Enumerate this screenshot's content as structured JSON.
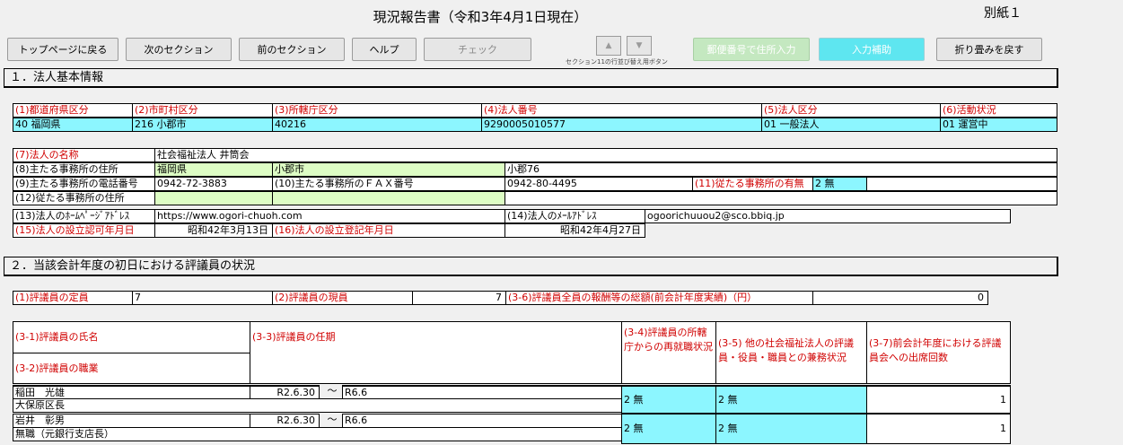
{
  "header": {
    "title": "現況報告書（令和3年4月1日現在）",
    "annex": "別紙１"
  },
  "toolbar": {
    "top_page": "トップページに戻る",
    "next_section": "次のセクション",
    "prev_section": "前のセクション",
    "help": "ヘルプ",
    "check": "チェック",
    "up_arrow": "▲",
    "down_arrow": "▼",
    "arrow_caption": "セクション11の行並び替え用ボタン",
    "postal_input": "郵便番号で住所入力",
    "input_support": "入力補助",
    "restore_fold": "折り畳みを戻す"
  },
  "section1": {
    "heading": "１．法人基本情報",
    "row1_labels": [
      "(1)都道府県区分",
      "(2)市町村区分",
      "(3)所轄庁区分",
      "(4)法人番号",
      "(5)法人区分",
      "(6)活動状況"
    ],
    "row1_values": [
      "40 福岡県",
      "216 小郡市",
      "40216",
      "9290005010577",
      "01 一般法人",
      "01 運営中"
    ],
    "name_label": "(7)法人の名称",
    "name_value": "社会福祉法人 井筒会",
    "address_label": "(8)主たる事務所の住所",
    "address_pref": "福岡県",
    "address_city": "小郡市",
    "address_detail": "小郡76",
    "phone_label": "(9)主たる事務所の電話番号",
    "phone_value": "0942-72-3883",
    "fax_label": "(10)主たる事務所のＦＡＸ番号",
    "fax_value": "0942-80-4495",
    "sub_office_label": "(11)従たる事務所の有無",
    "sub_office_value": "2 無",
    "sub_address_label": "(12)従たる事務所の住所",
    "homepage_label": "(13)法人のﾎｰﾑﾍﾟｰｼﾞｱﾄﾞﾚｽ",
    "homepage_value": "https://www.ogori-chuoh.com",
    "email_label": "(14)法人のﾒｰﾙｱﾄﾞﾚｽ",
    "email_value": "ogoorichuuou2@sco.bbiq.jp",
    "approval_label": "(15)法人の設立認可年月日",
    "approval_value": "昭和42年3月13日",
    "registration_label": "(16)法人の設立登記年月日",
    "registration_value": "昭和42年4月27日"
  },
  "section2": {
    "heading": "２．当該会計年度の初日における評議員の状況",
    "quota_label": "(1)評議員の定員",
    "quota_value": "7",
    "current_label": "(2)評議員の現員",
    "current_value": "7",
    "remuneration_label": "(3-6)評議員全員の報酬等の総額(前会計年度実績)（円）",
    "remuneration_value": "0",
    "col_name": "(3-1)評議員の氏名",
    "col_occupation": "(3-2)評議員の職業",
    "col_term": "(3-3)評議員の任期",
    "col_reemploy": "(3-4)評議員の所轄庁からの再就職状況",
    "col_concurrent": "(3-5) 他の社会福祉法人の評議員・役員・職員との兼務状況",
    "col_attendance": "(3-7)前会計年度における評議員会への出席回数",
    "tilde": "～",
    "rows": [
      {
        "name": "稲田　光雄",
        "occupation": "大保原区長",
        "term_start": "R2.6.30",
        "term_end": "R6.6",
        "reemploy": "2 無",
        "concurrent": "2 無",
        "attendance": "1"
      },
      {
        "name": "岩井　彰男",
        "occupation": "無職（元銀行支店長）",
        "term_start": "R2.6.30",
        "term_end": "R6.6",
        "reemploy": "2 無",
        "concurrent": "2 無",
        "attendance": "1"
      }
    ]
  },
  "colors": {
    "cyan_cell": "#8cf6ff",
    "light_green_cell": "#ddfdc4",
    "red_label": "#d00000"
  }
}
